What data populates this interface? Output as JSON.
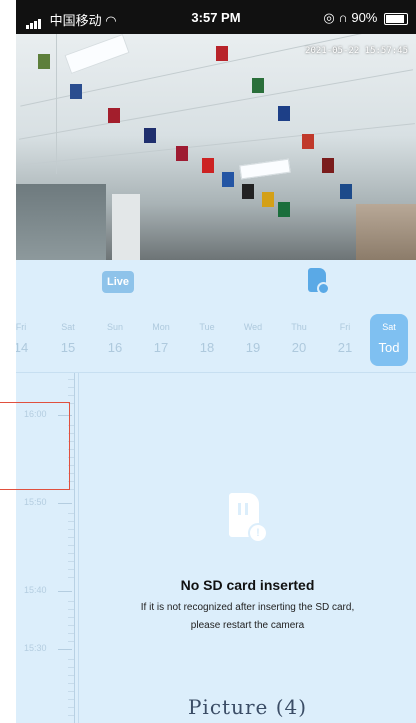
{
  "status_bar": {
    "carrier": "中国移动",
    "time": "3:57 PM",
    "battery": "90%"
  },
  "camera": {
    "timestamp": "2021-05-22 15:57:45"
  },
  "controls": {
    "live_label": "Live"
  },
  "dates": [
    {
      "dow": "Fri",
      "num": "14"
    },
    {
      "dow": "Sat",
      "num": "15"
    },
    {
      "dow": "Sun",
      "num": "16"
    },
    {
      "dow": "Mon",
      "num": "17"
    },
    {
      "dow": "Tue",
      "num": "18"
    },
    {
      "dow": "Wed",
      "num": "19"
    },
    {
      "dow": "Thu",
      "num": "20"
    },
    {
      "dow": "Fri",
      "num": "21"
    },
    {
      "dow": "Sat",
      "num": "Tod"
    }
  ],
  "timeline": {
    "labels": [
      "16:00",
      "15:50",
      "15:40",
      "15:30"
    ]
  },
  "message": {
    "title": "No SD card inserted",
    "line1": "If it is not recognized after inserting the SD card,",
    "line2": "please restart the camera"
  },
  "caption": "Picture (4)",
  "colors": {
    "accent": "#7fc0f1",
    "panel_bg": "#dceefb",
    "highlight": "#e0503e"
  }
}
